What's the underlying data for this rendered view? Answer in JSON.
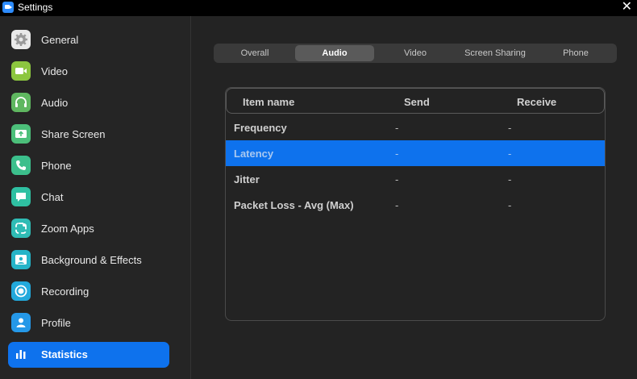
{
  "window": {
    "title": "Settings",
    "close_glyph": "✕"
  },
  "sidebar": {
    "items": [
      {
        "label": "General",
        "icon": "gear-icon",
        "color": "#e9e9e9"
      },
      {
        "label": "Video",
        "icon": "video-camera-icon",
        "color": "#8cc63f"
      },
      {
        "label": "Audio",
        "icon": "headphones-icon",
        "color": "#5fb760"
      },
      {
        "label": "Share Screen",
        "icon": "share-screen-icon",
        "color": "#4cbf7a"
      },
      {
        "label": "Phone",
        "icon": "phone-icon",
        "color": "#3cbf8c"
      },
      {
        "label": "Chat",
        "icon": "chat-icon",
        "color": "#2fc0a2"
      },
      {
        "label": "Zoom Apps",
        "icon": "apps-icon",
        "color": "#2fbcb5"
      },
      {
        "label": "Background & Effects",
        "icon": "background-icon",
        "color": "#25b4c8"
      },
      {
        "label": "Recording",
        "icon": "record-icon",
        "color": "#22a9dc"
      },
      {
        "label": "Profile",
        "icon": "profile-icon",
        "color": "#2598e8"
      },
      {
        "label": "Statistics",
        "icon": "bar-chart-icon",
        "color": "#0e72ed",
        "active": true
      }
    ]
  },
  "tabs": [
    {
      "label": "Overall"
    },
    {
      "label": "Audio",
      "active": true
    },
    {
      "label": "Video"
    },
    {
      "label": "Screen Sharing"
    },
    {
      "label": "Phone"
    }
  ],
  "table": {
    "headers": [
      "Item name",
      "Send",
      "Receive"
    ],
    "rows": [
      {
        "name": "Frequency",
        "send": "-",
        "receive": "-"
      },
      {
        "name": "Latency",
        "send": "-",
        "receive": "-",
        "selected": true
      },
      {
        "name": "Jitter",
        "send": "-",
        "receive": "-"
      },
      {
        "name": "Packet Loss - Avg (Max)",
        "send": "-",
        "receive": "-"
      }
    ]
  },
  "colors": {
    "accent": "#0e72ed",
    "background": "#232323"
  }
}
